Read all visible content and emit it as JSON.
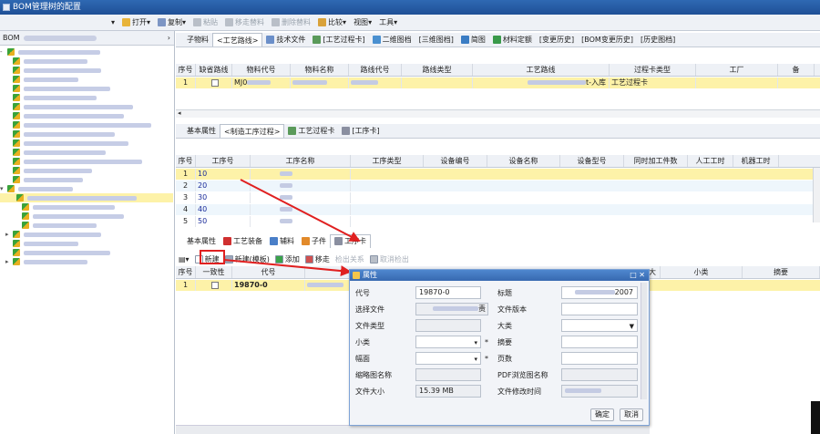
{
  "window": {
    "title": "BOM管理树的配置"
  },
  "menubar": {
    "items": [
      {
        "label": "打开",
        "icon": "folder-icon",
        "dis": false
      },
      {
        "label": "复制",
        "icon": "copy-icon",
        "dis": false
      },
      {
        "label": "粘贴",
        "icon": "paste-icon",
        "dis": true
      },
      {
        "label": "移走替料",
        "icon": "replace-icon",
        "dis": true
      },
      {
        "label": "删除替料",
        "icon": "delete-icon",
        "dis": true
      },
      {
        "label": "比较",
        "icon": "compare-icon",
        "dis": false
      },
      {
        "label": "视图",
        "icon": "",
        "dis": false
      },
      {
        "label": "工具",
        "icon": "",
        "dis": false
      }
    ]
  },
  "left_panel": {
    "header": "BOM"
  },
  "top_tabs": [
    {
      "label": "子物料",
      "active": false,
      "icon": ""
    },
    {
      "label": "<工艺路线>",
      "active": true,
      "icon": ""
    },
    {
      "label": "技术文件",
      "active": false,
      "icon": "doc-icon"
    },
    {
      "label": "[工艺过程卡]",
      "active": false,
      "icon": "card-icon"
    },
    {
      "label": "二维图档",
      "active": false,
      "icon": "drawing-icon"
    },
    {
      "label": "[三维图档]",
      "active": false,
      "icon": ""
    },
    {
      "label": "简图",
      "active": false,
      "icon": "sketch-icon"
    },
    {
      "label": "材料定额",
      "active": false,
      "icon": "material-icon"
    },
    {
      "label": "[变更历史]",
      "active": false,
      "icon": ""
    },
    {
      "label": "[BOM变更历史]",
      "active": false,
      "icon": ""
    },
    {
      "label": "[历史图档]",
      "active": false,
      "icon": ""
    }
  ],
  "route_grid": {
    "headers": [
      "序号",
      "缺省路线",
      "物料代号",
      "物料名称",
      "路线代号",
      "路线类型",
      "工艺路线",
      "过程卡类型",
      "工厂",
      "备"
    ],
    "rows": [
      {
        "no": "1",
        "code_prefix": "MJ0",
        "route_suffix": "t-入库",
        "card_type": "工艺过程卡"
      }
    ]
  },
  "mid_tabs": [
    {
      "label": "基本属性",
      "active": false,
      "icon": ""
    },
    {
      "label": "<制造工序过程>",
      "active": true,
      "icon": ""
    },
    {
      "label": "工艺过程卡",
      "active": false,
      "icon": "card-icon"
    },
    {
      "label": "[工序卡]",
      "active": false,
      "icon": "card2-icon"
    }
  ],
  "process_grid": {
    "headers": [
      "序号",
      "工序号",
      "工序名称",
      "工序类型",
      "设备编号",
      "设备名称",
      "设备型号",
      "同时加工件数",
      "人工工时",
      "机器工时"
    ],
    "rows": [
      {
        "no": "1",
        "step": "10"
      },
      {
        "no": "2",
        "step": "20"
      },
      {
        "no": "3",
        "step": "30"
      },
      {
        "no": "4",
        "step": "40"
      },
      {
        "no": "5",
        "step": "50"
      }
    ]
  },
  "bottom_tabs": [
    {
      "label": "基本属性",
      "active": false,
      "icon": ""
    },
    {
      "label": "工艺装备",
      "active": false,
      "icon": "magnet-icon"
    },
    {
      "label": "辅料",
      "active": false,
      "icon": "aux-icon"
    },
    {
      "label": "子件",
      "active": false,
      "icon": "parts-icon"
    },
    {
      "label": "工序卡",
      "active": true,
      "icon": "card2-icon"
    }
  ],
  "bottom_toolbar": [
    {
      "label": "新建",
      "icon": "new-icon",
      "dis": false
    },
    {
      "label": "新建(模板)",
      "icon": "template-icon",
      "dis": false
    },
    {
      "label": "添加",
      "icon": "add-icon",
      "dis": false
    },
    {
      "label": "移走",
      "icon": "remove-icon",
      "dis": false
    },
    {
      "label": "检出关系",
      "icon": "",
      "dis": true
    },
    {
      "label": "取消检出",
      "icon": "undo-icon",
      "dis": true
    }
  ],
  "card_grid": {
    "headers": [
      "序号",
      "一致性",
      "代号",
      "大",
      "小类",
      "摘要"
    ],
    "rows": [
      {
        "no": "1",
        "code": "19870-0"
      }
    ]
  },
  "dialog": {
    "title": "属性",
    "fields": {
      "code_label": "代号",
      "code_value": "19870-0",
      "title_label": "标题",
      "title_suffix": "2007",
      "file_label": "选择文件",
      "file_suffix": "责",
      "version_label": "文件版本",
      "type_label": "文件类型",
      "major_label": "大类",
      "minor_label": "小类",
      "summary_label": "摘要",
      "size_label": "幅面",
      "pages_label": "页数",
      "thumb_label": "缩略图名称",
      "pdf_label": "PDF浏览图名称",
      "filesize_label": "文件大小",
      "filesize_value": "15.39 MB",
      "mtime_label": "文件修改时间"
    },
    "ok": "确定",
    "cancel": "取消"
  },
  "colors": {
    "highlight": "#fdf2a8",
    "accent": "#3769b0",
    "annotation": "#e02020"
  }
}
